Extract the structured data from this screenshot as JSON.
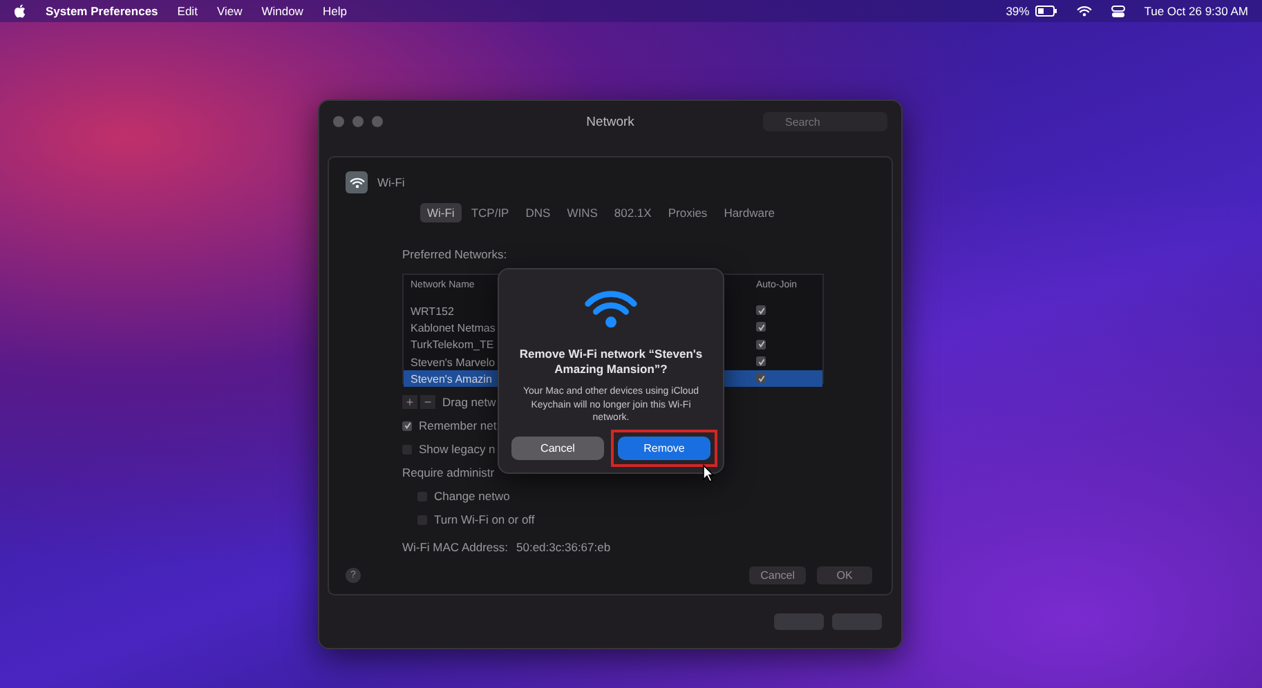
{
  "menu_bar": {
    "app": "System Preferences",
    "items": [
      "Edit",
      "View",
      "Window",
      "Help"
    ],
    "battery": "39%",
    "clock": "Tue Oct 26  9:30 AM"
  },
  "window": {
    "title": "Network",
    "search": {
      "placeholder": "Search"
    },
    "sheet": {
      "service": "Wi-Fi",
      "tabs": [
        {
          "label": "Wi-Fi",
          "selected": true
        },
        {
          "label": "TCP/IP",
          "selected": false
        },
        {
          "label": "DNS",
          "selected": false
        },
        {
          "label": "WINS",
          "selected": false
        },
        {
          "label": "802.1X",
          "selected": false
        },
        {
          "label": "Proxies",
          "selected": false
        },
        {
          "label": "Hardware",
          "selected": false
        }
      ],
      "preferred_label": "Preferred Networks:",
      "table": {
        "columns": [
          "Network Name",
          "Auto-Join"
        ],
        "rows": [
          {
            "name": "WRT152",
            "auto_join": true,
            "selected": false
          },
          {
            "name": "Kablonet Netmas",
            "auto_join": true,
            "selected": false
          },
          {
            "name": "TurkTelekom_TE",
            "auto_join": true,
            "selected": false
          },
          {
            "name": "Steven's Marvelo",
            "auto_join": true,
            "selected": false
          },
          {
            "name": "Steven's Amazin",
            "auto_join": true,
            "selected": true
          }
        ]
      },
      "list_buttons": [
        "+",
        "−"
      ],
      "drag_hint": "Drag netw",
      "help": "?",
      "options": [
        {
          "label": "Remember net",
          "checked": true
        },
        {
          "label": "Show legacy n",
          "checked": false
        }
      ],
      "require_label": "Require administr",
      "admin_options": [
        {
          "label": "Change netwo",
          "checked": false
        },
        {
          "label": "Turn Wi-Fi on or off",
          "checked": false
        }
      ],
      "mac_label": "Wi-Fi MAC Address:",
      "mac_value": "50:ed:3c:36:67:eb",
      "buttons": [
        "Cancel",
        "OK"
      ]
    }
  },
  "dialog": {
    "title": "Remove Wi-Fi network “Steven's Amazing Mansion”?",
    "message": "Your Mac and other devices using iCloud Keychain will no longer join this Wi-Fi network.",
    "buttons": [
      {
        "label": "Cancel",
        "kind": "secondary",
        "highlighted": false
      },
      {
        "label": "Remove",
        "kind": "primary",
        "highlighted": true
      }
    ]
  }
}
